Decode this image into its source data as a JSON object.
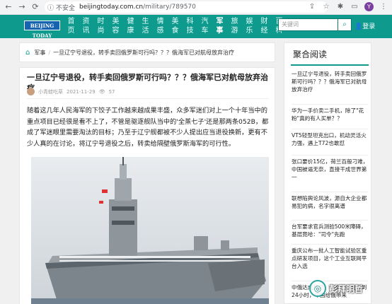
{
  "browser": {
    "insecure_label": "不安全",
    "url_host": "beijingtoday.com.cn",
    "url_path": "/military/789570"
  },
  "site": {
    "logo_text": "BEIJING TODAY",
    "nav": [
      {
        "top": "首",
        "bottom": "页"
      },
      {
        "top": "资",
        "bottom": "讯"
      },
      {
        "top": "时",
        "bottom": "尚"
      },
      {
        "top": "美",
        "bottom": "容"
      },
      {
        "top": "健",
        "bottom": "康"
      },
      {
        "top": "生",
        "bottom": "活"
      },
      {
        "top": "情",
        "bottom": "感"
      },
      {
        "top": "美",
        "bottom": "食"
      },
      {
        "top": "科",
        "bottom": "技"
      },
      {
        "top": "汽",
        "bottom": "车"
      },
      {
        "top": "军",
        "bottom": "事"
      },
      {
        "top": "旅",
        "bottom": "游"
      },
      {
        "top": "娱",
        "bottom": "乐"
      },
      {
        "top": "财",
        "bottom": "经"
      },
      {
        "top": "百",
        "bottom": "科"
      }
    ],
    "search_placeholder": "关键词",
    "login_label": "登录"
  },
  "breadcrumb": {
    "section": "军事",
    "current": "一旦辽宁号退役，转手卖回俄罗斯可行吗？？？俄海军已对航母放弃治疗"
  },
  "article": {
    "title": "一旦辽宁号退役，转手卖回俄罗斯可行吗？？？俄海军已对航母放弃治疗",
    "author": "小青蛙吃草",
    "date": "2021-11-29",
    "views": "57",
    "body": "随着这几年人民海军的下饺子工作越来越成果丰盛，众多军迷们对上一个十年当中的重点项目已经很是看不上了，不管是驱逐舰队当中的'全蒸七子'还是那两条052B，都成了军迷眼里需要淘汰的目标；乃至于辽宁舰都被不少人提出应当退役换新，更有不少人真的在讨论，将辽宁号退役之后，转卖给隔壁俄罗斯海军的可行性。"
  },
  "sidebar": {
    "title": "聚合阅读",
    "items": [
      "一旦辽宁号退役，转手卖回俄罗斯可行吗？？？俄海军已对航母放弃治疗",
      "华为一手价卖二手机，除了\"花粉\"真的有人买单？？",
      "VT5轻型坦克出口，机动灵活火力强，遇上T72也敢怼",
      "张口要价15亿，荷兰百般刁难，中国被逼无奈，直接干成世界第一",
      "联想陷舆论风波，源自大企业都易犯的病，名字很离谱",
      "台军要求官兵测验500米障碍，基层竟哈：\"司令\"先跑",
      "重庆公布一批人工智能试验区重点研发项目，这个工业互联网平台入选",
      "中俄达成共识，俄罗斯驱逐不到24小时，中国给俄带来"
    ]
  },
  "watermark": "彭拜明哲"
}
